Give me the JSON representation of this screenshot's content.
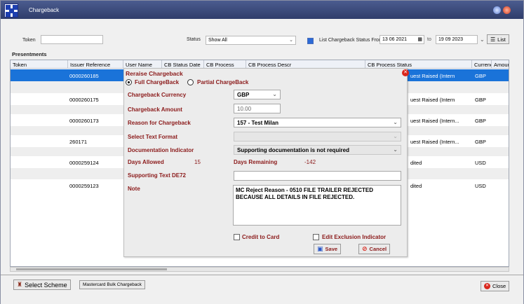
{
  "window": {
    "title": "Chargeback"
  },
  "filters": {
    "token_label": "Token",
    "token_value": "",
    "status_label": "Status",
    "status_value": "Show All",
    "list_status_label": "List Chargeback Status From",
    "list_status_checked": true,
    "date_from": "13 06 2021",
    "to_label": "to",
    "date_to": "19 09 2023",
    "list_button": "List"
  },
  "grid": {
    "section_title": "Presentments",
    "columns": [
      "Token",
      "Issuer Reference",
      "User Name",
      "CB Status Date",
      "CB Process",
      "CB Process Descr",
      "CB Process Status",
      "Currency",
      "Amount"
    ],
    "rows": [
      {
        "token": "",
        "issuer_ref": "0000260185",
        "status": "uest Raised (Intern",
        "currency": "GBP"
      },
      {
        "token": "",
        "issuer_ref": "",
        "status": "",
        "currency": ""
      },
      {
        "token": "",
        "issuer_ref": "0000260175",
        "status": "uest Raised (Intern",
        "currency": "GBP"
      },
      {
        "token": "",
        "issuer_ref": "",
        "status": "",
        "currency": ""
      },
      {
        "token": "",
        "issuer_ref": "0000260173",
        "status": "uest Raised (Intern...",
        "currency": "GBP"
      },
      {
        "token": "",
        "issuer_ref": "",
        "status": "",
        "currency": ""
      },
      {
        "token": "",
        "issuer_ref": "260171",
        "status": "uest Raised (Intern...",
        "currency": "GBP"
      },
      {
        "token": "",
        "issuer_ref": "",
        "status": "",
        "currency": ""
      },
      {
        "token": "",
        "issuer_ref": "0000259124",
        "status": "dited",
        "currency": "USD"
      },
      {
        "token": "",
        "issuer_ref": "",
        "status": "",
        "currency": ""
      },
      {
        "token": "",
        "issuer_ref": "0000259123",
        "status": "dited",
        "currency": "USD"
      }
    ]
  },
  "dialog": {
    "title": "Reraise Chargeback",
    "full_label": "Full ChargeBack",
    "partial_label": "Partial ChargeBack",
    "full_selected": true,
    "currency_label": "Chargeback Currency",
    "currency_value": "GBP",
    "amount_label": "Chargeback Amount",
    "amount_value": "10.00",
    "reason_label": "Reason for Chargeback",
    "reason_value": "157 - Test Milan",
    "text_format_label": "Select Text Format",
    "text_format_value": "",
    "doc_indicator_label": "Documentation Indicator",
    "doc_indicator_value": "Supporting documentation is not required",
    "days_allowed_label": "Days Allowed",
    "days_allowed_value": "15",
    "days_remaining_label": "Days Remaining",
    "days_remaining_value": "-142",
    "supporting_text_label": "Supporting Text DE72",
    "supporting_text_value": "",
    "note_label": "Note",
    "note_value": "MC Reject Reason - 0510 FILE TRAILER REJECTED BECAUSE ALL DETAILS IN FILE REJECTED.",
    "credit_to_card_label": "Credit to Card",
    "edit_exclusion_label": "Edit Exclusion Indicator",
    "save_label": "Save",
    "cancel_label": "Cancel"
  },
  "footer": {
    "select_scheme_label": "Select Scheme",
    "bulk_label": "Mastercard Bulk Chargeback",
    "close_label": "Close"
  },
  "colors": {
    "title_bar": "#3a4a7a",
    "selection": "#1a73d9",
    "label_red": "#8b1a1a"
  }
}
